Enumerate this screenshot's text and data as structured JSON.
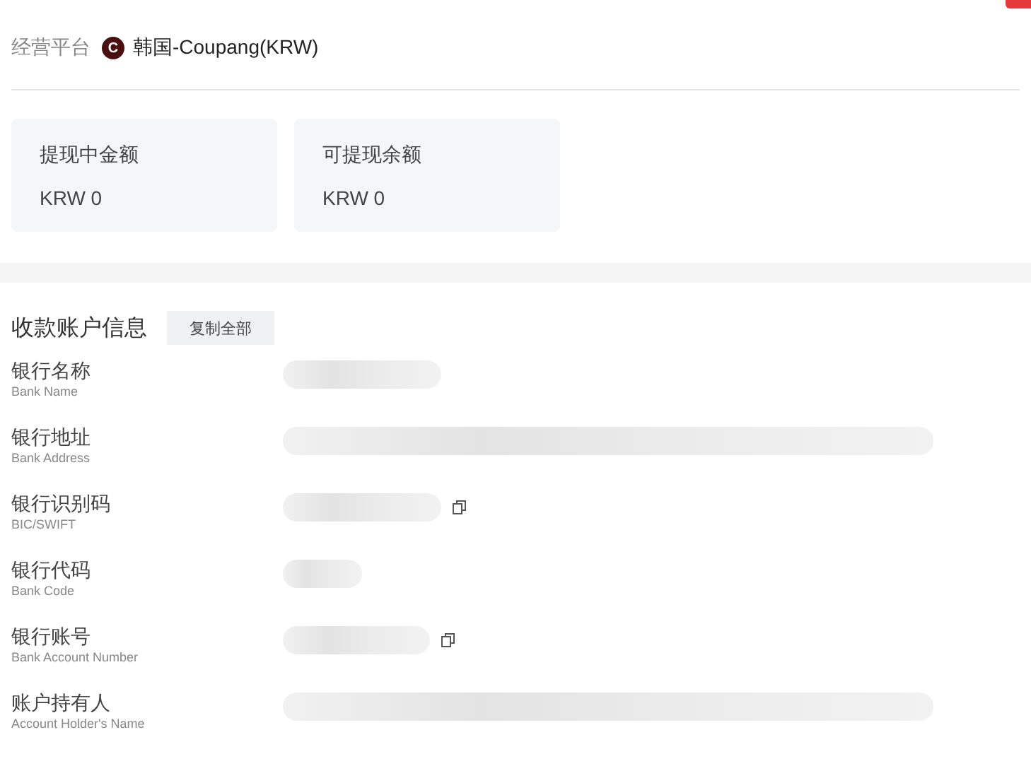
{
  "platform": {
    "label": "经营平台",
    "badge": "C",
    "value": "韩国-Coupang(KRW)"
  },
  "balances": [
    {
      "label": "提现中金额",
      "value": "KRW 0"
    },
    {
      "label": "可提现余额",
      "value": "KRW 0"
    }
  ],
  "account_info": {
    "title": "收款账户信息",
    "copy_all_button": "复制全部",
    "fields": [
      {
        "label": "银行名称",
        "sublabel": "Bank Name",
        "copyable": false
      },
      {
        "label": "银行地址",
        "sublabel": "Bank Address",
        "copyable": false
      },
      {
        "label": "银行识别码",
        "sublabel": "BIC/SWIFT",
        "copyable": true
      },
      {
        "label": "银行代码",
        "sublabel": "Bank Code",
        "copyable": false
      },
      {
        "label": "银行账号",
        "sublabel": "Bank Account Number",
        "copyable": true
      },
      {
        "label": "账户持有人",
        "sublabel": "Account Holder's Name",
        "copyable": false
      }
    ]
  }
}
